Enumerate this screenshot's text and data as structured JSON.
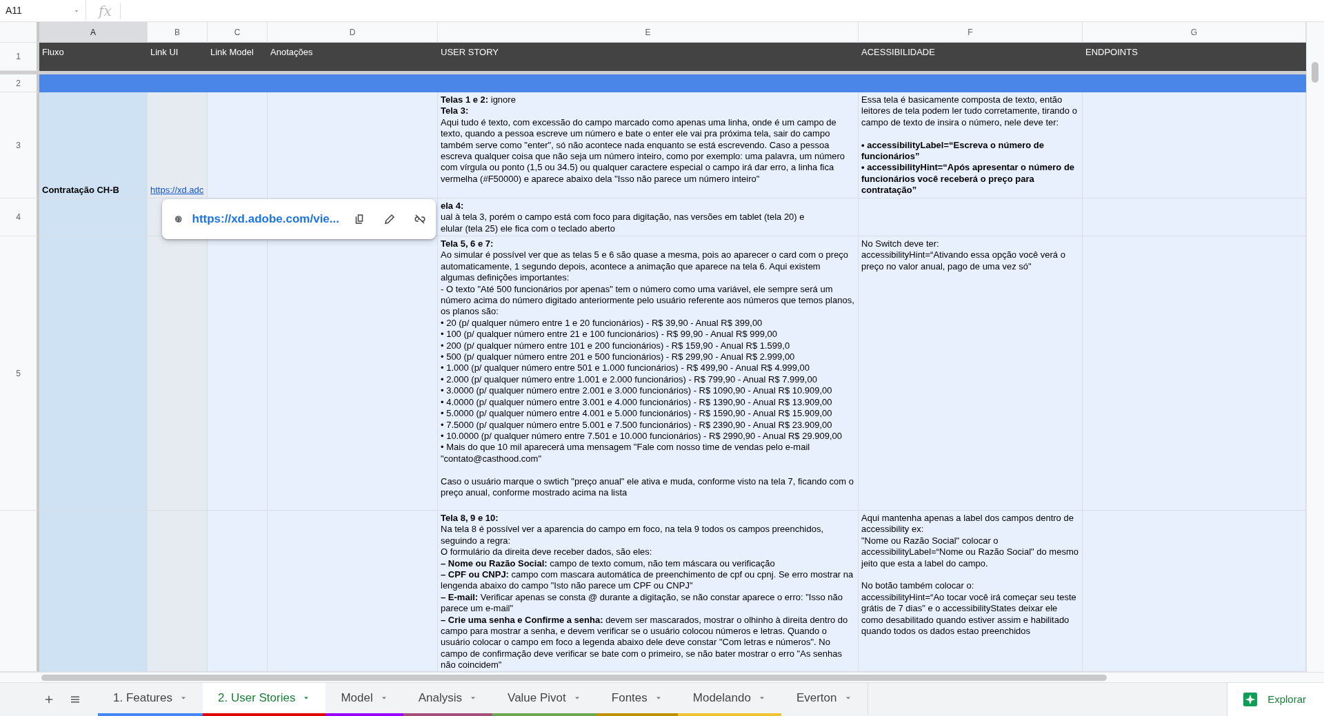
{
  "name_box": "A11",
  "formula_label": "fx",
  "columns": [
    {
      "letter": "A",
      "selected": true,
      "kind": "bold"
    },
    {
      "letter": "B",
      "selected": false,
      "kind": "link"
    },
    {
      "letter": "C",
      "selected": false,
      "kind": "text"
    },
    {
      "letter": "D",
      "selected": false,
      "kind": "text"
    },
    {
      "letter": "E",
      "selected": false,
      "kind": "text"
    },
    {
      "letter": "F",
      "selected": false,
      "kind": "text"
    },
    {
      "letter": "G",
      "selected": false,
      "kind": "text"
    }
  ],
  "rows": [
    {
      "number": "1",
      "kind": "header",
      "cells": [
        "Fluxo",
        "Link UI",
        "Link Model",
        "Anotações",
        "USER STORY",
        "ACESSIBILIDADE",
        "ENDPOINTS"
      ]
    },
    {
      "number": "2",
      "kind": "band",
      "cells": [
        null,
        null,
        null,
        null,
        null,
        null,
        null
      ]
    },
    {
      "number": "3",
      "kind": "body",
      "cells": [
        "Contratação CH-B",
        "https://xd.adc",
        null,
        null,
        "**Telas 1 e 2:** ignore\n**Tela 3:**\nAqui tudo é texto, com excessão do campo marcado como apenas uma linha, onde é um campo de texto, quando a pessoa escreve um número e bate o enter ele vai pra próxima tela, sair do campo também serve como \"enter\", só não acontece nada enquanto se está escrevendo. Caso a pessoa escreva qualquer coisa que não seja um número inteiro, como por exemplo: uma palavra, um número com vírgula ou ponto (1,5 ou 34.5) ou qualquer caractere especial o campo irá dar erro, a linha fica vermelha (#F50000) e aparece abaixo dela \"Isso não parece um número inteiro\"",
        "Essa tela é basicamente composta de texto, então leitores de tela podem ler tudo corretamente, tirando o campo de texto de insira o número, nele deve ter:\n\n**• accessibilityLabel=“Escreva o número de funcionários”\n• accessibilityHint=“Após apresentar o número de funcionários você receberá o preço para contratação”**",
        null
      ]
    },
    {
      "number": "4",
      "kind": "body",
      "cells": [
        null,
        null,
        null,
        null,
        "**ela 4:**\nual à tela 3, porém o campo está com foco para digitação, nas versões em tablet (tela 20) e\nelular (tela 25) ele fica com o teclado aberto",
        null,
        null
      ]
    },
    {
      "number": "5",
      "kind": "body",
      "cells": [
        null,
        null,
        null,
        null,
        "**Tela 5, 6 e 7:**\nAo simular é possível ver que as telas 5 e 6 são quase a mesma, pois ao aparecer o card com o preço automaticamente, 1 segundo depois, acontece a animação que aparece na tela 6. Aqui existem algumas definições importantes:\n- O texto \"Até 500 funcionários por apenas\" tem o número como uma variável, ele sempre será um número acima do número digitado anteriormente pelo usuário referente aos números que temos planos, os planos são:\n• 20 (p/ qualquer número entre 1 e 20 funcionários) - R$ 39,90 - Anual R$ 399,00\n• 100 (p/ qualquer número entre 21 e 100 funcionários) - R$ 99,90 - Anual R$ 999,00\n• 200 (p/ qualquer número entre 101 e 200 funcionários) - R$ 159,90 - Anual R$ 1.599,0\n• 500 (p/ qualquer número entre 201 e 500 funcionários) - R$ 299,90 - Anual R$ 2.999,00\n• 1.000 (p/ qualquer número entre 501 e 1.000 funcionários) - R$ 499,90 - Anual R$ 4.999,00\n• 2.000 (p/ qualquer número entre 1.001 e 2.000 funcionários) - R$ 799,90 - Anual R$ 7.999,00\n• 3.0000 (p/ qualquer número entre 2.001 e 3.000 funcionários) - R$ 1090,90 - Anual R$ 10.909,00\n• 4.0000 (p/ qualquer número entre 3.001 e 4.000 funcionários) - R$ 1390,90 - Anual R$ 13.909,00\n• 5.0000 (p/ qualquer número entre 4.001 e 5.000 funcionários) - R$ 1590,90 - Anual R$ 15.909,00\n• 7.5000 (p/ qualquer número entre 5.001 e 7.500 funcionários) - R$ 2390,90 - Anual R$ 23.909,00\n• 10.0000 (p/ qualquer número entre 7.501 e 10.000 funcionários) - R$ 2990,90 - Anual R$ 29.909,00\n• Mais do que 10 mil aparecerá uma mensagem \"Fale com nosso time de vendas pelo e-mail \"contato@casthood.com\"\n\nCaso o usuário marque o swtich \"preço anual\" ele ativa e muda, conforme visto na tela 7, ficando com o preço anual, conforme mostrado acima na lista",
        "No Switch deve ter:\naccessibilityHint=“Ativando essa opção você verá o preço no valor anual, pago de uma vez só\"",
        null
      ]
    },
    {
      "kind": "body",
      "cells": [
        null,
        null,
        null,
        null,
        "**Tela 8, 9 e 10:**\nNa tela 8 é possível ver a aparencia do campo em foco, na tela 9 todos os campos preenchidos, seguindo a regra:\nO formulário da direita deve receber dados, são eles:\n**– Nome ou Razão Social:** campo de texto comum, não tem máscara ou verificação\n**– CPF ou CNPJ:** campo com mascara automática de preenchimento de cpf ou cpnj. Se erro mostrar na lengenda abaixo do campo \"Isto não parece um CPF ou CNPJ\"\n**– E-mail:** Verificar apenas se consta @ durante a digitação, se não constar aparece o erro: \"Isso não parece um e-mail\"\n**– Crie uma senha e Confirme a senha:** devem ser mascarados, mostrar o olhinho à direita dentro do campo para mostrar a senha, e devem verificar se o usuário colocou números e letras. Quando o usuário colocar o campo em foco a legenda abaixo dele deve constar \"Com letras e números\". No campo de confirmação deve verificar se bate com o primeiro, se não bater mostrar o erro \"As senhas não coincidem\"",
        "Aqui mantenha apenas a label dos campos dentro de accessibility ex:\n\"Nome ou Razão Social\" colocar o accessibilityLabel=“Nome ou Razão Social\" do mesmo jeito que esta a label do campo.\n\nNo botão também colocar o:\naccessibilityHint=“Ao tocar você irá começar seu teste grátis de 7 dias\" e o accessibilityStates deixar ele como desabilitado quando estiver assim e habilitado quando todos os dados estao preenchidos",
        null
      ]
    }
  ],
  "link_popup": {
    "url": "https://xd.adobe.com/vie..."
  },
  "sheet_tabs": [
    {
      "label": "1. Features",
      "selected": false,
      "color": "#4285f4"
    },
    {
      "label": "2. User Stories",
      "selected": true,
      "color": "#e00000"
    },
    {
      "label": "Model",
      "selected": false,
      "color": "#9900ff"
    },
    {
      "label": "Analysis",
      "selected": false,
      "color": "#a64d79"
    },
    {
      "label": "Value Pivot",
      "selected": false,
      "color": "#6aa84f"
    },
    {
      "label": "Fontes",
      "selected": false,
      "color": "#bf9000"
    },
    {
      "label": "Modelando",
      "selected": false,
      "color": "#f1c232"
    },
    {
      "label": "Everton",
      "selected": false
    }
  ],
  "explore_button": "Explorar"
}
